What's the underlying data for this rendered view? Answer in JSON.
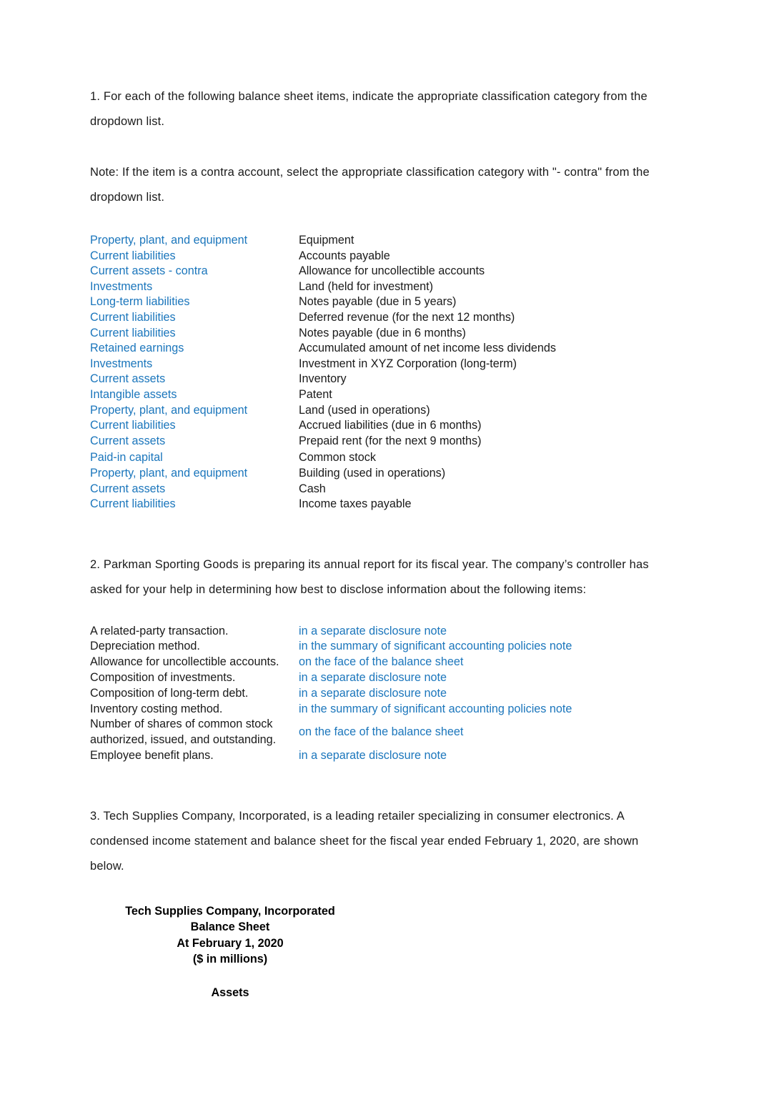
{
  "document": {
    "q1": {
      "intro": "1. For each of the following balance sheet items, indicate the appropriate classification category from the dropdown list.",
      "note": "Note: If the item is a contra account, select the appropriate classification category with \"- contra\" from the dropdown list.",
      "rows": [
        {
          "classification": "Property, plant, and equipment",
          "item": "Equipment"
        },
        {
          "classification": "Current liabilities",
          "item": "Accounts payable"
        },
        {
          "classification": "Current assets - contra",
          "item": "Allowance for uncollectible accounts"
        },
        {
          "classification": "Investments",
          "item": "Land (held for investment)"
        },
        {
          "classification": "Long-term liabilities",
          "item": "Notes payable (due in 5 years)"
        },
        {
          "classification": "Current liabilities",
          "item": "Deferred revenue (for the next 12 months)"
        },
        {
          "classification": "Current liabilities",
          "item": "Notes payable (due in 6 months)"
        },
        {
          "classification": "Retained earnings",
          "item": "Accumulated amount of net income less dividends"
        },
        {
          "classification": "Investments",
          "item": "Investment in XYZ Corporation (long-term)"
        },
        {
          "classification": "Current assets",
          "item": "Inventory"
        },
        {
          "classification": "Intangible assets",
          "item": "Patent"
        },
        {
          "classification": "Property, plant, and equipment",
          "item": "Land (used in operations)"
        },
        {
          "classification": "Current liabilities",
          "item": "Accrued liabilities (due in 6 months)"
        },
        {
          "classification": "Current assets",
          "item": "Prepaid rent (for the next 9 months)"
        },
        {
          "classification": "Paid-in capital",
          "item": "Common stock"
        },
        {
          "classification": "Property, plant, and equipment",
          "item": "Building (used in operations)"
        },
        {
          "classification": "Current assets",
          "item": "Cash"
        },
        {
          "classification": "Current liabilities",
          "item": "Income taxes payable"
        }
      ]
    },
    "q2": {
      "intro": "2. Parkman Sporting Goods is preparing its annual report for its fiscal year. The company’s controller has asked for your help in determining how best to disclose information about the following items:",
      "rows": [
        {
          "label": "A related-party transaction.",
          "disclosure": "in a separate disclosure note"
        },
        {
          "label": "Depreciation method.",
          "disclosure": "in the summary of significant accounting policies note"
        },
        {
          "label": "Allowance for uncollectible accounts.",
          "disclosure": "on the face of the balance sheet"
        },
        {
          "label": "Composition of investments.",
          "disclosure": "in a separate disclosure note"
        },
        {
          "label": "Composition of long-term debt.",
          "disclosure": "in a separate disclosure note"
        },
        {
          "label": "Inventory costing method.",
          "disclosure": "in the summary of significant accounting policies note"
        },
        {
          "label": "Number of shares of common stock authorized, issued, and outstanding.",
          "disclosure": "on the face of the balance sheet"
        },
        {
          "label": "Employee benefit plans.",
          "disclosure": "in a separate disclosure note"
        }
      ]
    },
    "q3": {
      "intro": "3. Tech Supplies Company, Incorporated, is a leading retailer specializing in consumer electronics. A condensed income statement and balance sheet for the fiscal year ended February 1, 2020, are shown below.",
      "statement_heading": {
        "company": "Tech Supplies Company, Incorporated",
        "statement": "Balance Sheet",
        "date": "At February 1, 2020",
        "units": "($ in millions)",
        "section": "Assets"
      }
    }
  },
  "colors": {
    "answer_blue": "#1b76bc",
    "body_text": "#1a1a1a",
    "page_background": "#ffffff"
  }
}
